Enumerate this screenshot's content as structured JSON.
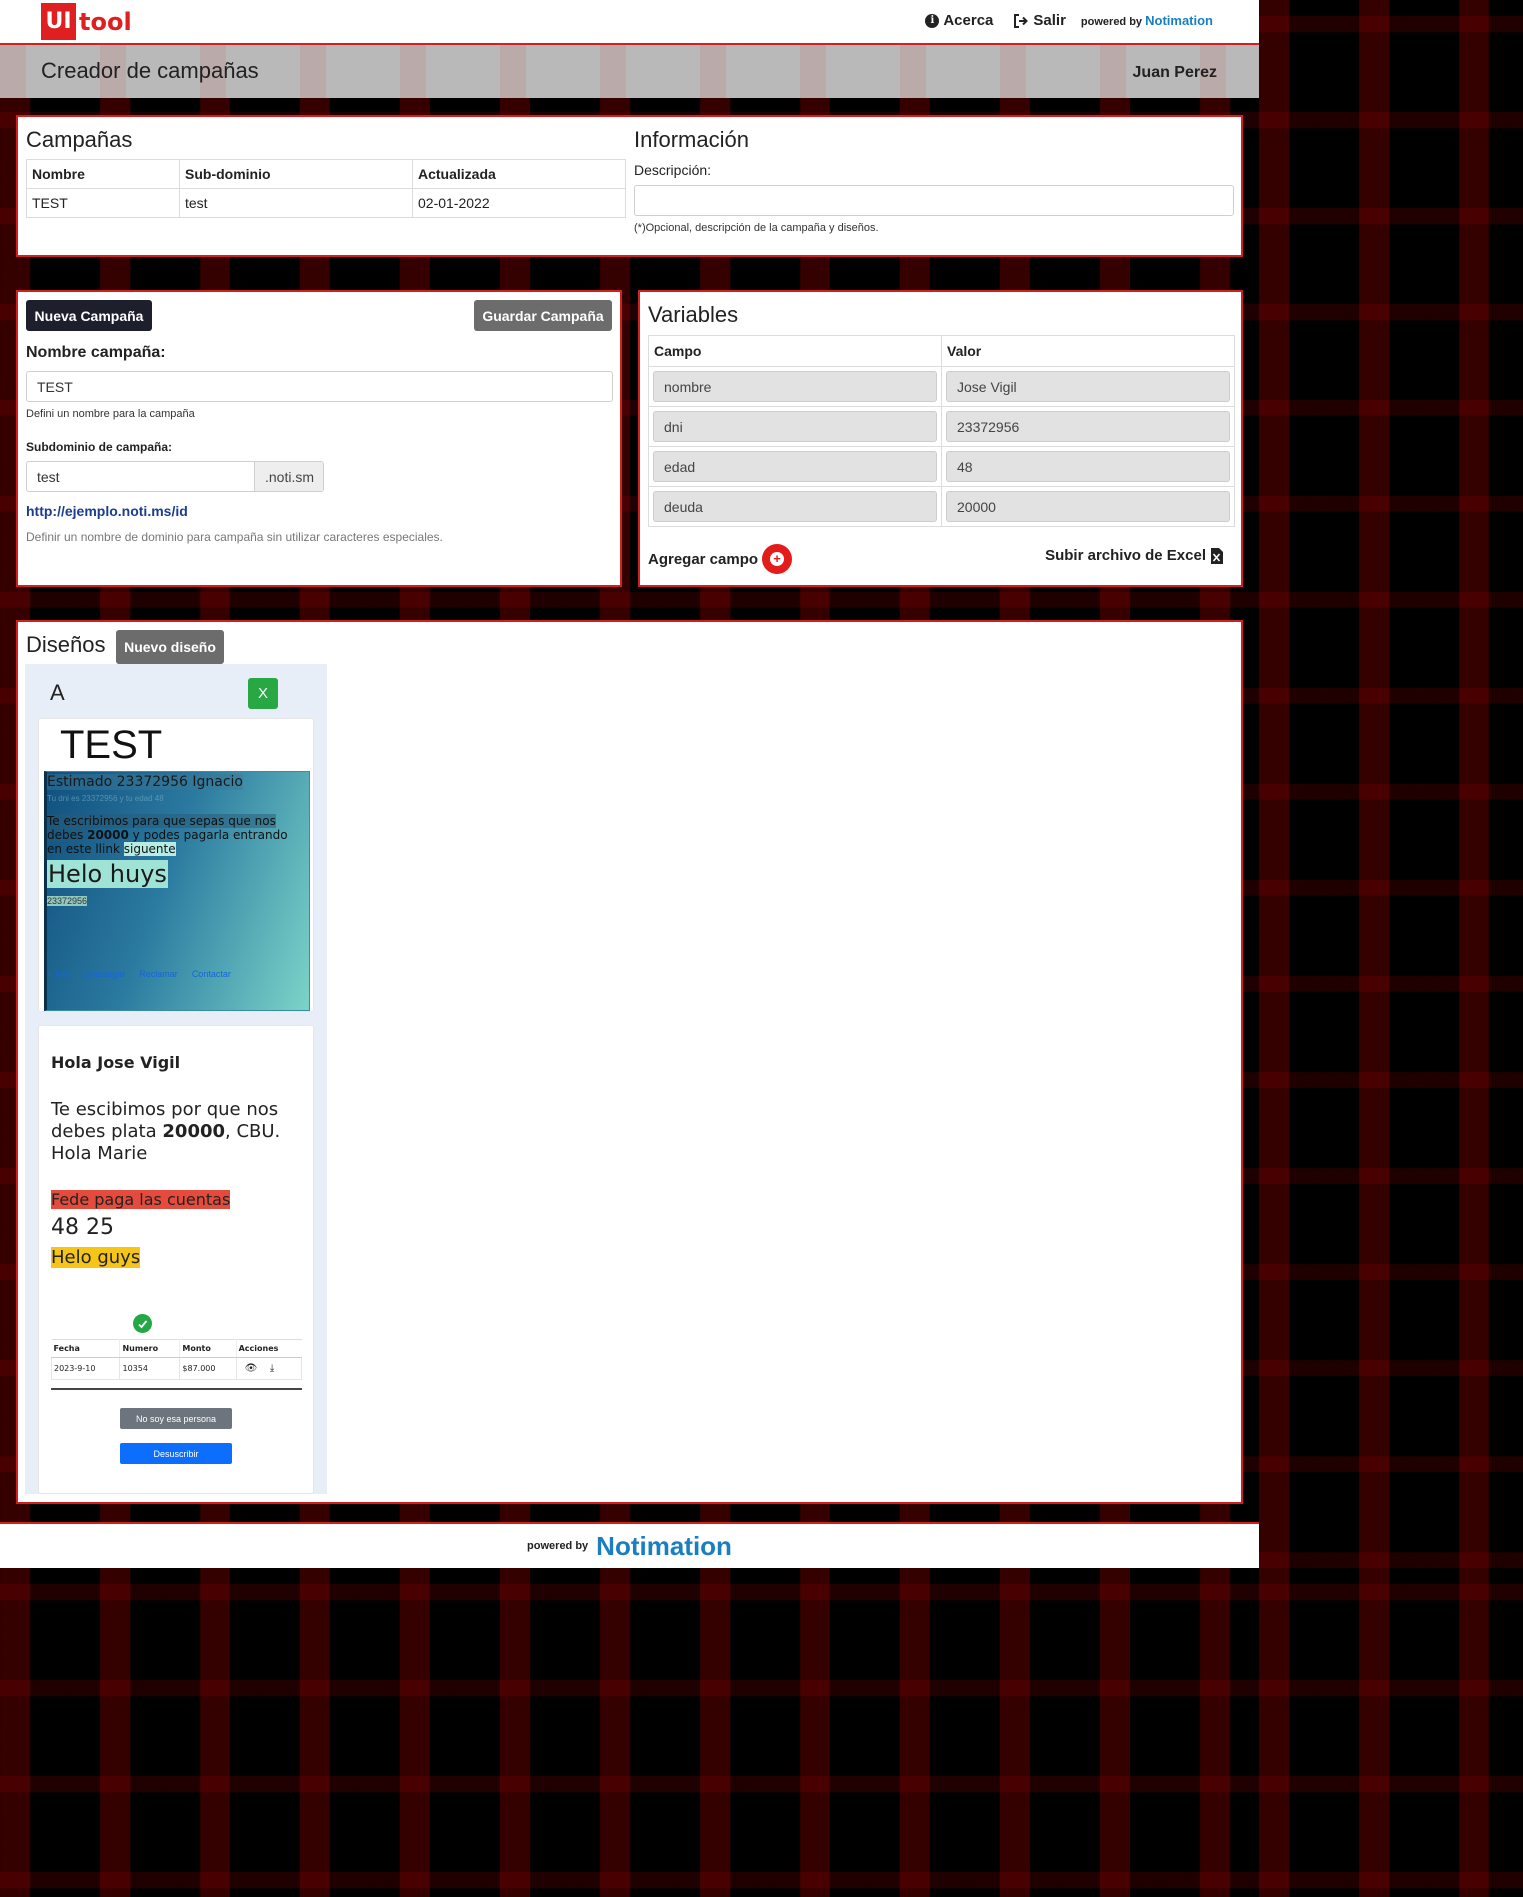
{
  "nav": {
    "logo_ui": "UI",
    "logo_tool": "tool",
    "about": "Acerca",
    "logout": "Salir",
    "powered_by": "powered by",
    "brand": "Notimation"
  },
  "header": {
    "title": "Creador de campañas",
    "user": "Juan Perez"
  },
  "campaigns": {
    "title": "Campañas",
    "columns": [
      "Nombre",
      "Sub-dominio",
      "Actualizada"
    ],
    "rows": [
      [
        "TEST",
        "test",
        "02-01-2022"
      ]
    ]
  },
  "info": {
    "title": "Información",
    "description_label": "Descripción:",
    "description_value": "",
    "hint": "(*)Opcional, descripción de la campaña y diseños."
  },
  "editor": {
    "new_button": "Nueva Campaña",
    "save_button": "Guardar Campaña",
    "name_label": "Nombre campaña:",
    "name_value": "TEST",
    "name_hint": "Defini un nombre para la campaña",
    "subdomain_label": "Subdominio de campaña:",
    "subdomain_value": "test",
    "subdomain_suffix": ".noti.sm",
    "example_link": "http://ejemplo.noti.ms/id",
    "subdomain_hint": "Definir un nombre de dominio para campaña sin utilizar caracteres especiales."
  },
  "variables": {
    "title": "Variables",
    "columns": [
      "Campo",
      "Valor"
    ],
    "rows": [
      [
        "nombre",
        "Jose Vigil"
      ],
      [
        "dni",
        "23372956"
      ],
      [
        "edad",
        "48"
      ],
      [
        "deuda",
        "20000"
      ]
    ],
    "add_field": "Agregar campo",
    "upload_excel": "Subir archivo de Excel"
  },
  "designs": {
    "title": "Diseños",
    "new_button": "Nuevo diseño",
    "design_name": "A",
    "delete_button": "X",
    "preview1": {
      "title": "TEST",
      "greeting": "Estimado 23372956 Ignacio",
      "subline": "Tu dni es 23372956 y tu edad 48",
      "text_pre": "Te escribimos para que sepas que nos debes",
      "text_amount": "20000",
      "text_post": "y podes pagarla entrando en este llink",
      "text_tail": "siguente",
      "big": "Helo huys",
      "small": "23372956",
      "links": [
        "+ Info",
        "Descargar",
        "Reclamar",
        "Contactar"
      ]
    },
    "preview2": {
      "greeting": "Hola Jose Vigil",
      "para_pre": "Te escibimos por que nos debes plata",
      "para_amount": "20000",
      "para_post": ", CBU. Hola Marie",
      "red_label": "Fede paga las cuentas",
      "numbers": "48 25",
      "yellow_label": "Helo guys",
      "table_columns": [
        "Fecha",
        "Numero",
        "Monto",
        "Acciones"
      ],
      "table_row": [
        "2023-9-10",
        "10354",
        "$87.000"
      ],
      "not_me_button": "No soy esa persona",
      "unsubscribe_button": "Desuscribir"
    }
  },
  "footer": {
    "powered_by": "powered by",
    "brand": "Notimation"
  },
  "colors": {
    "accent_red": "#d21f1f",
    "brand_blue": "#1a7fc1",
    "dark_button": "#1d1f2c"
  }
}
